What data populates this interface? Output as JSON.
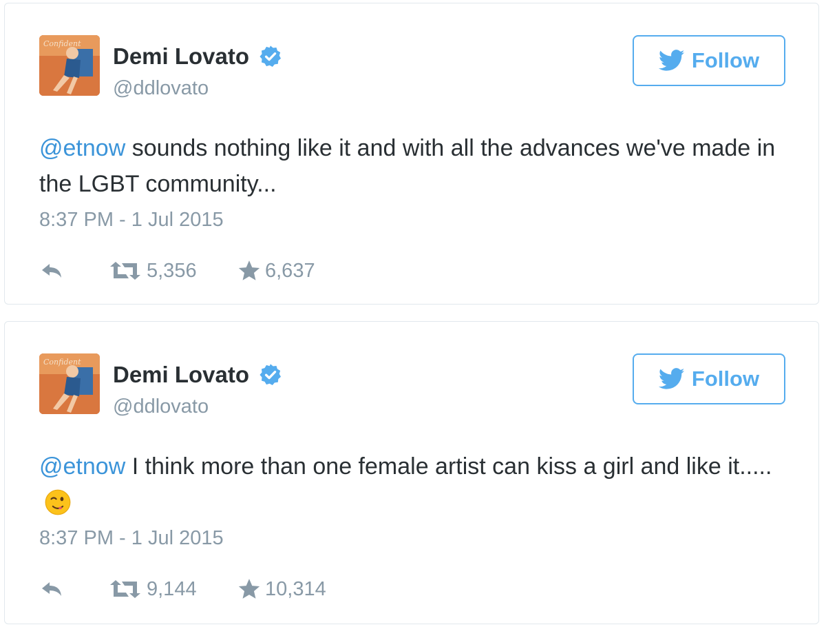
{
  "tweets": [
    {
      "display_name": "Demi Lovato",
      "handle": "@ddlovato",
      "follow_label": "Follow",
      "mention": "@etnow",
      "text": " sounds nothing like it and with all the advances we've made in the LGBT community...",
      "timestamp": "8:37 PM - 1 Jul 2015",
      "retweets": "5,356",
      "favorites": "6,637"
    },
    {
      "display_name": "Demi Lovato",
      "handle": "@ddlovato",
      "follow_label": "Follow",
      "mention": "@etnow",
      "text": "  I think more than one female artist can kiss a girl and like it.....",
      "timestamp": "8:37 PM - 1 Jul 2015",
      "retweets": "9,144",
      "favorites": "10,314"
    }
  ],
  "icons": {
    "verified": "verified-badge-icon",
    "bird": "twitter-bird-icon",
    "reply": "reply-icon",
    "retweet": "retweet-icon",
    "favorite": "star-icon",
    "emoji": "winking-face-emoji"
  },
  "colors": {
    "accent": "#55acee",
    "link": "#3b94d9",
    "muted": "#8899a6",
    "text": "#292f33",
    "border": "#e1e8ed"
  }
}
